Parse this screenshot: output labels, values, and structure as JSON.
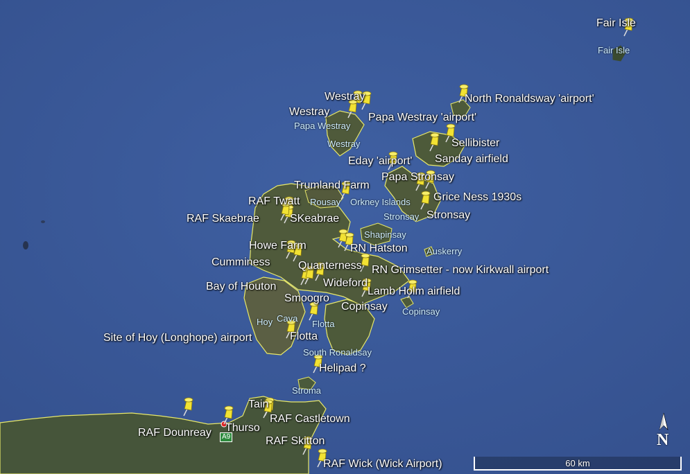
{
  "map": {
    "pins": [
      {
        "id": "fair-isle",
        "label": "Fair Isle"
      },
      {
        "id": "westray-1",
        "label": "Westray"
      },
      {
        "id": "westray-2",
        "label": "Westray"
      },
      {
        "id": "north-ronaldsway",
        "label": "North Ronaldsway 'airport'"
      },
      {
        "id": "papa-westray",
        "label": "Papa Westray 'airport'"
      },
      {
        "id": "sellibister",
        "label": "Sellibister"
      },
      {
        "id": "sanday",
        "label": "Sanday airfield"
      },
      {
        "id": "eday",
        "label": "Eday 'airport'"
      },
      {
        "id": "papa-stronsay",
        "label": "Papa Stronsay"
      },
      {
        "id": "trumland",
        "label": "Trumland Farm"
      },
      {
        "id": "grice-ness",
        "label": "Grice Ness 1930s"
      },
      {
        "id": "raf-twatt",
        "label": "RAF Twatt"
      },
      {
        "id": "stronsay",
        "label": "Stronsay"
      },
      {
        "id": "raf-skaebrae",
        "label": "RAF Skaebrae"
      },
      {
        "id": "skeabrae",
        "label": "SKeabrae"
      },
      {
        "id": "howe-farm",
        "label": "Howe Farm"
      },
      {
        "id": "rn-hatston",
        "label": "RN Hatston"
      },
      {
        "id": "cumminess",
        "label": "Cumminess"
      },
      {
        "id": "quanterness",
        "label": "Quanterness"
      },
      {
        "id": "rn-grimsetter",
        "label": "RN Grimsetter - now Kirkwall airport"
      },
      {
        "id": "bay-of-houton",
        "label": "Bay of Houton"
      },
      {
        "id": "wideford",
        "label": "Wideford"
      },
      {
        "id": "lamb-holm",
        "label": "Lamb Holm airfield"
      },
      {
        "id": "smoogro",
        "label": "Smoogro"
      },
      {
        "id": "copinsay",
        "label": "Copinsay"
      },
      {
        "id": "site-of-hoy",
        "label": "Site of Hoy (Longhope) airport"
      },
      {
        "id": "flotta",
        "label": "Flotta"
      },
      {
        "id": "helipad",
        "label": "Helipad ?"
      },
      {
        "id": "tain",
        "label": "Tain"
      },
      {
        "id": "raf-castletown",
        "label": "RAF Castletown"
      },
      {
        "id": "raf-dounreay",
        "label": "RAF Dounreay"
      },
      {
        "id": "thurso",
        "label": "Thurso"
      },
      {
        "id": "raf-skitton",
        "label": "RAF Skitton"
      },
      {
        "id": "raf-wick",
        "label": "RAF Wick (Wick Airport)"
      }
    ],
    "places": [
      {
        "id": "fair-isle-place",
        "label": "Fair Isle"
      },
      {
        "id": "papa-westray-place",
        "label": "Papa Westray"
      },
      {
        "id": "westray-place",
        "label": "Westray"
      },
      {
        "id": "rousay",
        "label": "Rousay"
      },
      {
        "id": "orkney-islands",
        "label": "Orkney Islands"
      },
      {
        "id": "stronsay-place",
        "label": "Stronsay"
      },
      {
        "id": "shapinsay",
        "label": "Shapinsay"
      },
      {
        "id": "auskerry",
        "label": "Auskerry"
      },
      {
        "id": "copinsay-place",
        "label": "Copinsay"
      },
      {
        "id": "hoy",
        "label": "Hoy"
      },
      {
        "id": "cava",
        "label": "Cava"
      },
      {
        "id": "flotta-place",
        "label": "Flotta"
      },
      {
        "id": "south-ronaldsay",
        "label": "South Ronaldsay"
      },
      {
        "id": "stroma",
        "label": "Stroma"
      }
    ],
    "road_label": "A9",
    "scale_label": "60 km",
    "north_label": "N",
    "colors": {
      "sea": "#3b5a9a",
      "land": "#4d5a3a",
      "coast": "#e8e86a",
      "pin": "#f2e233"
    }
  }
}
